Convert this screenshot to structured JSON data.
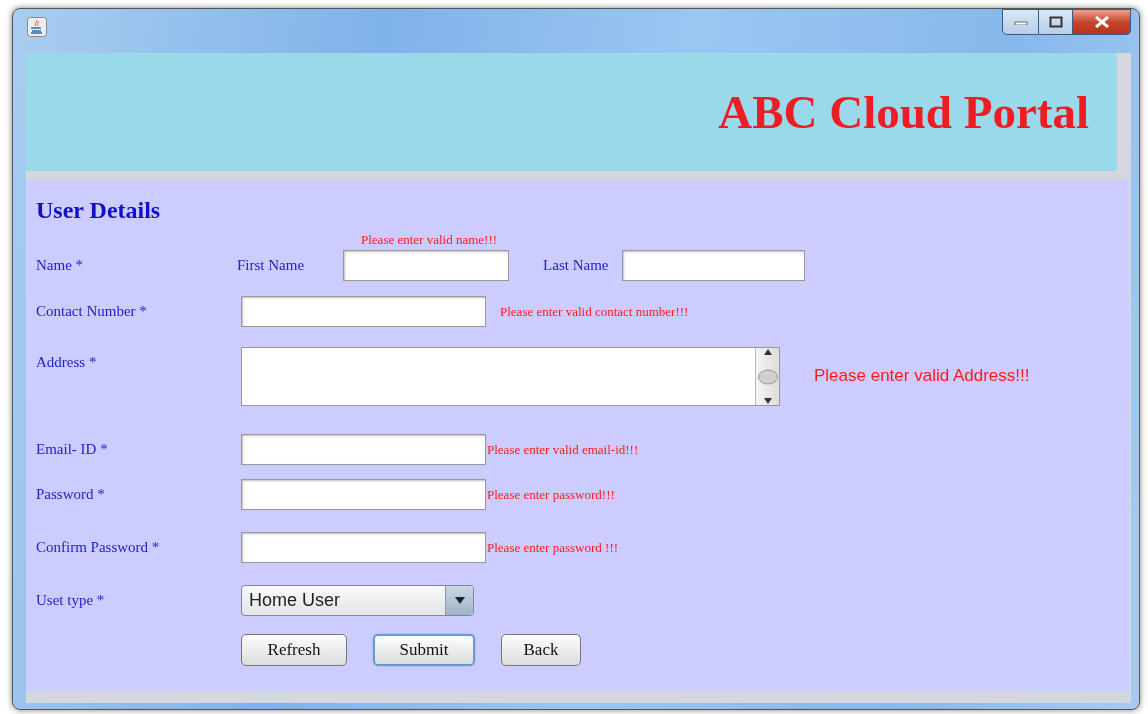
{
  "header": {
    "title": "ABC Cloud Portal"
  },
  "form": {
    "heading": "User Details",
    "name_row": {
      "error": "Please enter valid name!!!",
      "label": "Name *",
      "first_label": "First Name",
      "last_label": "Last Name"
    },
    "fields": [
      {
        "kind": "text",
        "label": "Contact Number *",
        "error": "Please enter valid contact number!!!"
      },
      {
        "kind": "textarea",
        "label": "Address *",
        "error": "Please enter valid Address!!!"
      },
      {
        "kind": "text",
        "label": "Email- ID *",
        "error": "Please enter valid email-id!!!"
      },
      {
        "kind": "password",
        "label": "Password *",
        "error": "Please enter password!!!"
      },
      {
        "kind": "password",
        "label": "Confirm Password *",
        "error": "Please enter password !!!"
      },
      {
        "kind": "select",
        "label": "Uset type *",
        "value": "Home User"
      }
    ],
    "buttons": [
      {
        "label": "Refresh",
        "focused": false
      },
      {
        "label": "Submit",
        "focused": true
      },
      {
        "label": "Back",
        "focused": false
      }
    ]
  }
}
